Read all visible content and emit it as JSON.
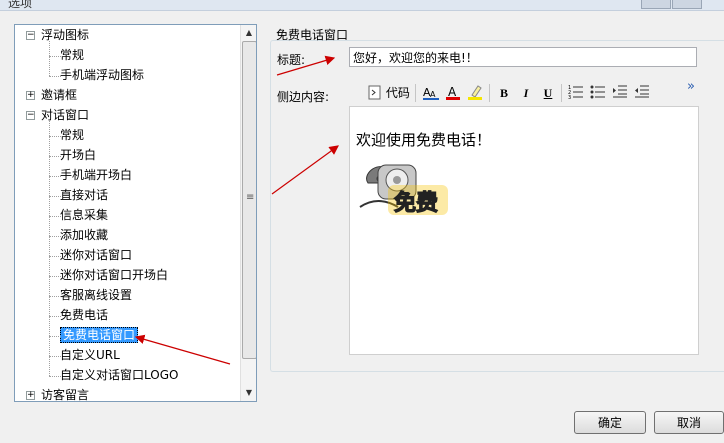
{
  "window": {
    "title": "选项"
  },
  "tree": {
    "items": [
      {
        "label": "浮动图标",
        "level": 0,
        "expander": "−"
      },
      {
        "label": "常规",
        "level": 1
      },
      {
        "label": "手机端浮动图标",
        "level": 1
      },
      {
        "label": "邀请框",
        "level": 0,
        "expander": "+"
      },
      {
        "label": "对话窗口",
        "level": 0,
        "expander": "−"
      },
      {
        "label": "常规",
        "level": 1
      },
      {
        "label": "开场白",
        "level": 1
      },
      {
        "label": "手机端开场白",
        "level": 1
      },
      {
        "label": "直接对话",
        "level": 1
      },
      {
        "label": "信息采集",
        "level": 1
      },
      {
        "label": "添加收藏",
        "level": 1
      },
      {
        "label": "迷你对话窗口",
        "level": 1
      },
      {
        "label": "迷你对话窗口开场白",
        "level": 1
      },
      {
        "label": "客服离线设置",
        "level": 1
      },
      {
        "label": "免费电话",
        "level": 1
      },
      {
        "label": "免费电话窗口",
        "level": 1,
        "selected": true
      },
      {
        "label": "自定义URL",
        "level": 1
      },
      {
        "label": "自定义对话窗口LOGO",
        "level": 1
      },
      {
        "label": "访客留言",
        "level": 0,
        "expander": "+"
      }
    ]
  },
  "panel": {
    "group_title": "免费电话窗口",
    "title_label": "标题:",
    "title_value": "您好，欢迎您的来电!！",
    "sidebar_label": "侧边内容:",
    "toolbar": {
      "code_label": "代码",
      "more": "»"
    },
    "editor": {
      "welcome_text": "欢迎使用免费电话！",
      "image_text": "免费"
    }
  },
  "buttons": {
    "ok": "确定",
    "cancel": "取消"
  },
  "colors": {
    "selection": "#3399ff",
    "annotation_arrow": "#cc0000"
  }
}
